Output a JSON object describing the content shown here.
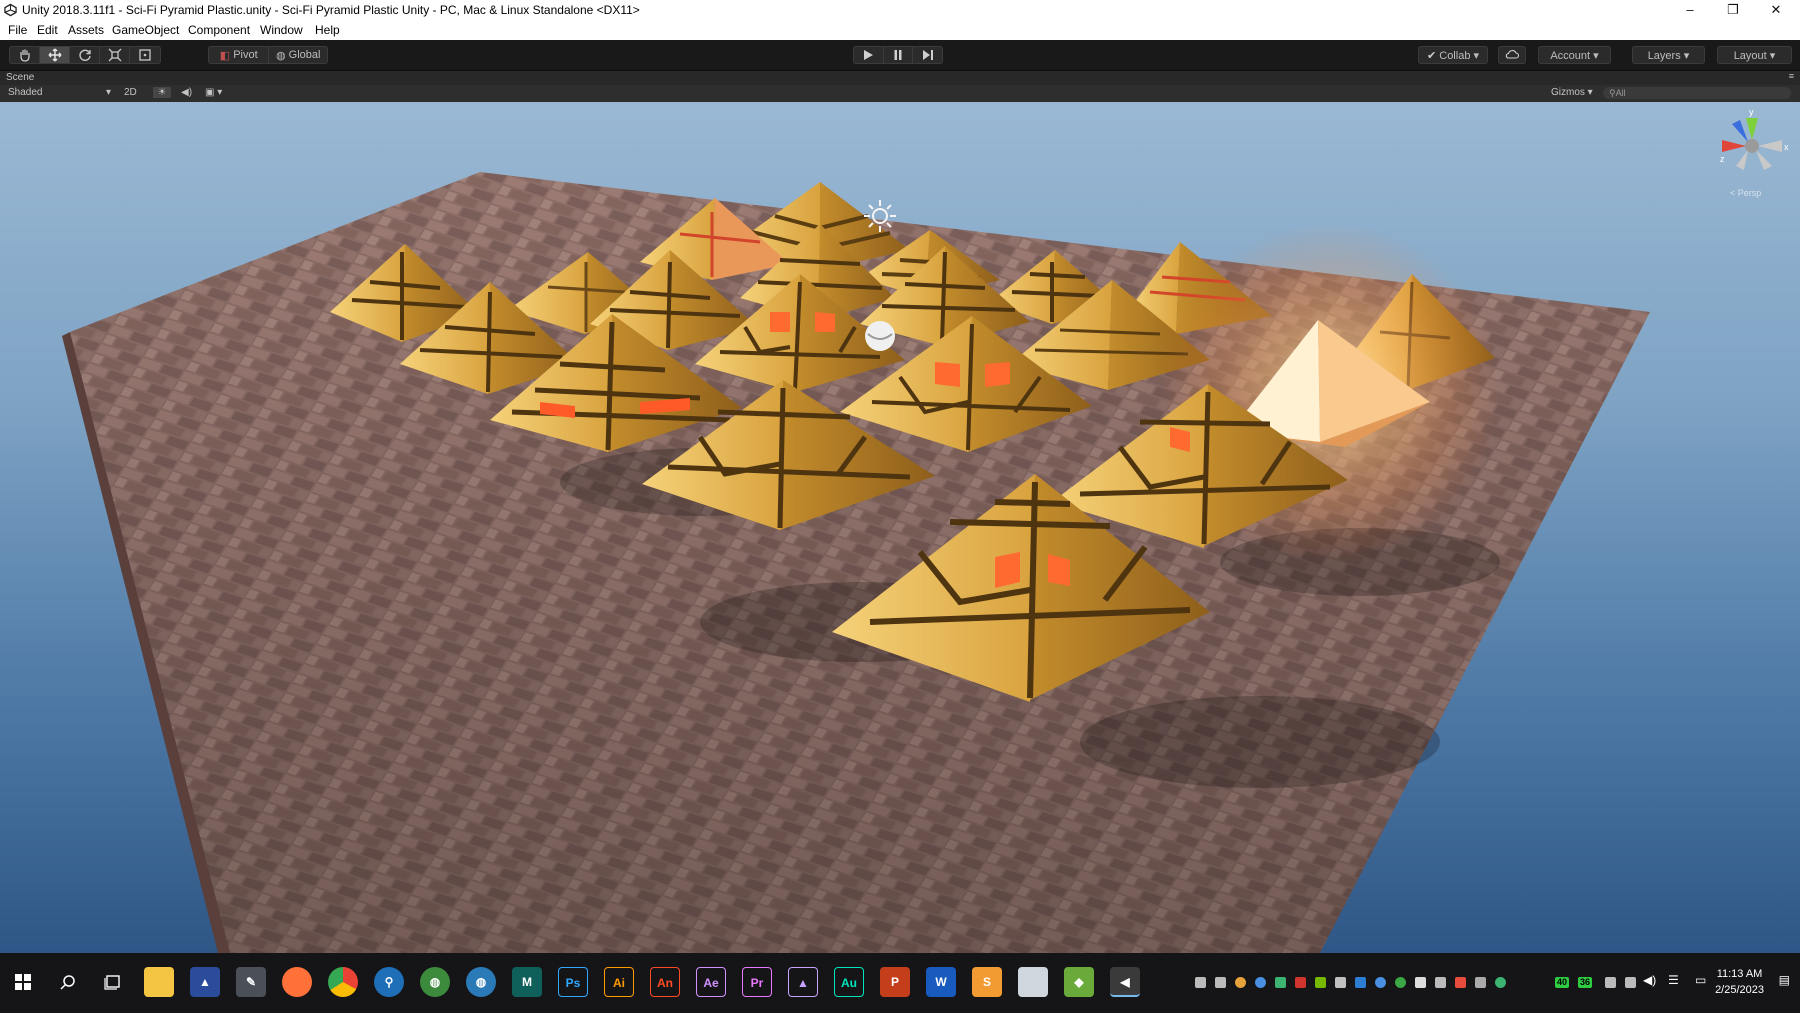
{
  "window": {
    "title": "Unity 2018.3.11f1 - Sci-Fi Pyramid Plastic.unity - Sci-Fi Pyramid Plastic Unity - PC, Mac & Linux Standalone <DX11>",
    "minimize": "–",
    "maximize": "❐",
    "close": "✕"
  },
  "menu": [
    "File",
    "Edit",
    "Assets",
    "GameObject",
    "Component",
    "Window",
    "Help"
  ],
  "toolbar": {
    "pivot": "Pivot",
    "global": "Global",
    "collab": "Collab ▾",
    "account": "Account",
    "layers": "Layers",
    "layout": "Layout"
  },
  "scene": {
    "tab_label": "Scene",
    "shading_mode": "Shaded",
    "mode_2d": "2D",
    "gizmos": "Gizmos",
    "search_placeholder": "All",
    "persp_label": "< Persp",
    "axis_y": "y",
    "axis_x": "x",
    "axis_z": "z"
  },
  "clock": {
    "time": "11:13 AM",
    "date": "2/25/2023"
  },
  "taskbar_apps": [
    {
      "name": "photoshop",
      "label": "Ps",
      "color": "#31a8ff",
      "bg": "#001e36"
    },
    {
      "name": "illustrator",
      "label": "Ai",
      "color": "#ff9a00",
      "bg": "#330000"
    },
    {
      "name": "animate",
      "label": "An",
      "color": "#ff4b22",
      "bg": "#330000"
    },
    {
      "name": "after-effects",
      "label": "Ae",
      "color": "#d291ff",
      "bg": "#00005b"
    },
    {
      "name": "premiere",
      "label": "Pr",
      "color": "#ea77ff",
      "bg": "#00005b"
    },
    {
      "name": "visual-studio",
      "label": "▲",
      "color": "#c7a2ff",
      "bg": "#2d1b5e"
    },
    {
      "name": "audition",
      "label": "Au",
      "color": "#00e4bb",
      "bg": "#00312a"
    },
    {
      "name": "powerpoint",
      "label": "P",
      "color": "#ffffff",
      "bg": "#c43e1c"
    },
    {
      "name": "word",
      "label": "W",
      "color": "#ffffff",
      "bg": "#185abd"
    },
    {
      "name": "sublime-text",
      "label": "S",
      "color": "#ffffff",
      "bg": "#f29b32"
    }
  ],
  "tray": {
    "badge1": "40",
    "badge2": "36"
  },
  "colors": {
    "gold": "#e3b64b",
    "gold_dark": "#7a5418",
    "glow": "#ff9a4a",
    "brick": "#8a6a64"
  }
}
